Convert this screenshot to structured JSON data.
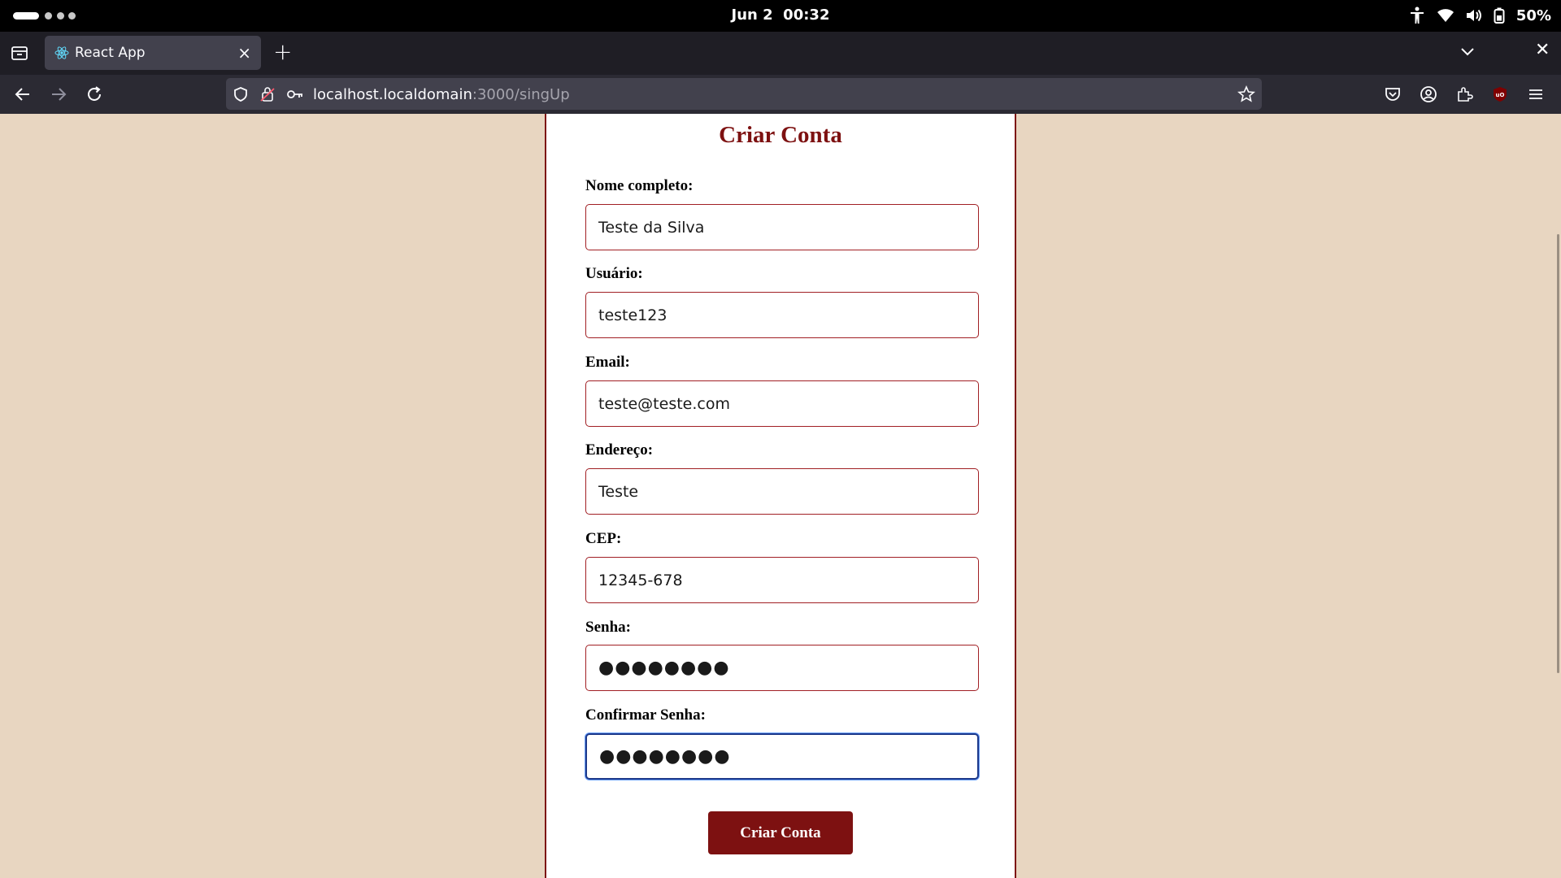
{
  "system": {
    "clock": "Jun 2  00:32",
    "battery": "50%"
  },
  "browser": {
    "tab": {
      "title": "React App",
      "close_glyph": "×"
    },
    "new_tab_glyph": "+",
    "window_close_glyph": "✕",
    "url": {
      "host": "localhost.localdomain",
      "path": ":3000/singUp"
    }
  },
  "form": {
    "title": "Criar Conta",
    "fields": [
      {
        "label": "Nome completo:",
        "value": "Teste da Silva"
      },
      {
        "label": "Usuário:",
        "value": "teste123"
      },
      {
        "label": "Email:",
        "value": "teste@teste.com"
      },
      {
        "label": "Endereço:",
        "value": "Teste"
      },
      {
        "label": "CEP:",
        "value": "12345-678"
      },
      {
        "label": "Senha:",
        "value": "●●●●●●●●"
      },
      {
        "label": "Confirmar Senha:",
        "value": "●●●●●●●●"
      }
    ],
    "submit_label": "Criar Conta"
  },
  "colors": {
    "page_bg": "#e8d6c1",
    "accent": "#7d1111",
    "input_border": "#a11f24",
    "focus_border": "#1e3a8a"
  }
}
